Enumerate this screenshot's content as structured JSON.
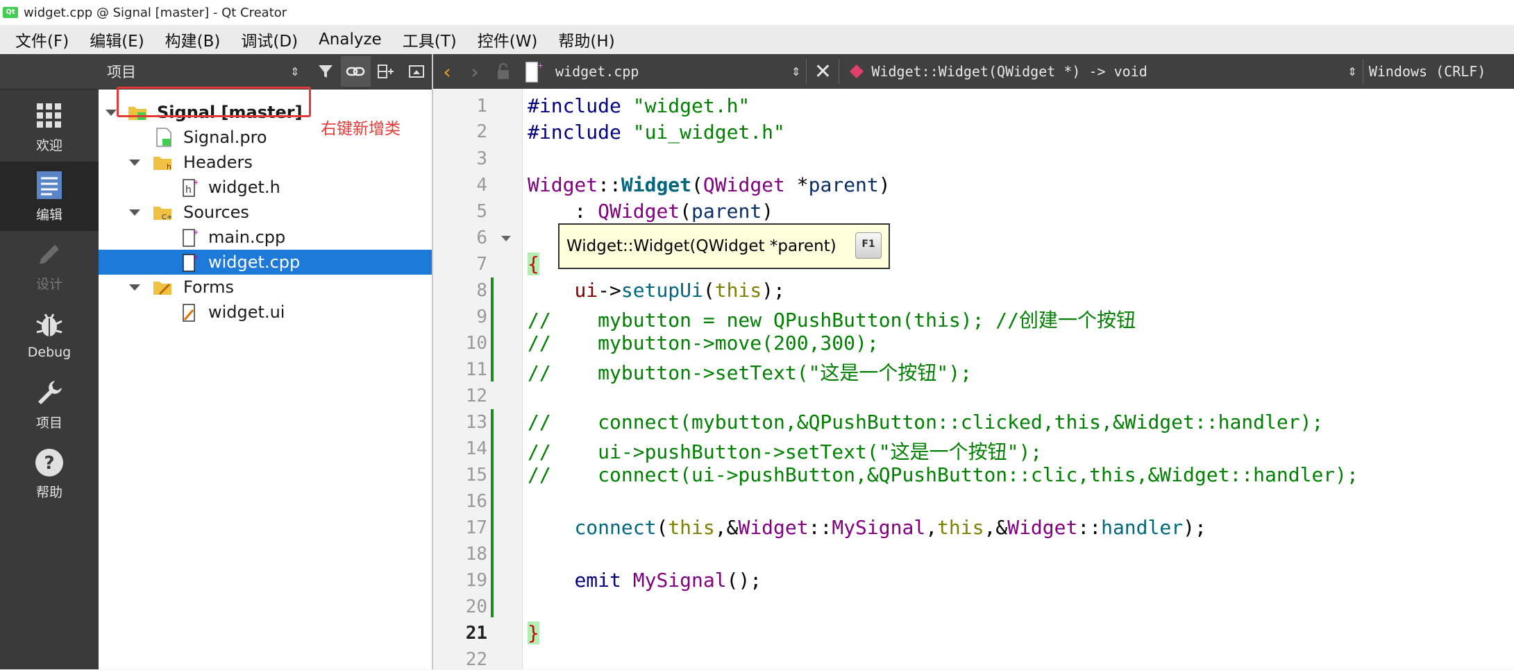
{
  "window": {
    "title": "widget.cpp @ Signal [master] - Qt Creator",
    "app_icon": "Qt"
  },
  "menu": [
    "文件(F)",
    "编辑(E)",
    "构建(B)",
    "调试(D)",
    "Analyze",
    "工具(T)",
    "控件(W)",
    "帮助(H)"
  ],
  "modes": [
    {
      "label": "欢迎",
      "icon": "grid-icon"
    },
    {
      "label": "编辑",
      "icon": "document-icon",
      "active": true
    },
    {
      "label": "设计",
      "icon": "pencil-icon",
      "disabled": true
    },
    {
      "label": "Debug",
      "icon": "bug-icon"
    },
    {
      "label": "项目",
      "icon": "wrench-icon"
    },
    {
      "label": "帮助",
      "icon": "help-icon"
    }
  ],
  "project_panel": {
    "title": "项目",
    "tree": [
      {
        "label": "Signal [master]",
        "bold": true,
        "selected": false
      },
      {
        "label": "Signal.pro"
      },
      {
        "label": "Headers"
      },
      {
        "label": "widget.h"
      },
      {
        "label": "Sources"
      },
      {
        "label": "main.cpp"
      },
      {
        "label": "widget.cpp",
        "selected": true
      },
      {
        "label": "Forms"
      },
      {
        "label": "widget.ui"
      }
    ],
    "annotation": "右键新增类"
  },
  "editor_toolbar": {
    "file": "widget.cpp",
    "symbol": "Widget::Widget(QWidget *) -> void",
    "line_ending": "Windows (CRLF)"
  },
  "editor": {
    "current_line": 21,
    "line_numbers": [
      "1",
      "2",
      "3",
      "4",
      "5",
      "6",
      "7",
      "8",
      "9",
      "10",
      "11",
      "12",
      "13",
      "14",
      "15",
      "16",
      "17",
      "18",
      "19",
      "20",
      "21",
      "22"
    ],
    "tooltip": "Widget::Widget(QWidget *parent)",
    "tooltip_key": "F1",
    "lines": {
      "l1a": "#include ",
      "l1b": "\"widget.h\"",
      "l2a": "#include ",
      "l2b": "\"ui_widget.h\"",
      "l4a": "Widget",
      "l4b": "::",
      "l4c": "Widget",
      "l4d": "(",
      "l4e": "QWidget",
      "l4f": " *",
      "l4g": "parent",
      "l4h": ")",
      "l5a": "    : ",
      "l5b": "QWidget",
      "l5c": "(",
      "l5d": "parent",
      "l5e": ")",
      "l7": "{",
      "l8a": "    ",
      "l8b": "ui",
      "l8c": "->",
      "l8d": "setupUi",
      "l8e": "(",
      "l8f": "this",
      "l8g": ");",
      "l9": "//    mybutton = new QPushButton(this); //创建一个按钮",
      "l10": "//    mybutton->move(200,300);",
      "l11": "//    mybutton->setText(\"这是一个按钮\");",
      "l13": "//    connect(mybutton,&QPushButton::clicked,this,&Widget::handler);",
      "l14": "//    ui->pushButton->setText(\"这是一个按钮\");",
      "l15": "//    connect(ui->pushButton,&QPushButton::clic,this,&Widget::handler);",
      "l17a": "    ",
      "l17b": "connect",
      "l17c": "(",
      "l17d": "this",
      "l17e": ",&",
      "l17f": "Widget",
      "l17g": "::",
      "l17h": "MySignal",
      "l17i": ",",
      "l17j": "this",
      "l17k": ",&",
      "l17l": "Widget",
      "l17m": "::",
      "l17n": "handler",
      "l17o": ");",
      "l19a": "    ",
      "l19b": "emit",
      "l19c": " ",
      "l19d": "MySignal",
      "l19e": "();",
      "l21": "}"
    }
  },
  "colors": {
    "accent": "#1e7ad8",
    "annotation": "#e53935",
    "comment": "#008000"
  }
}
